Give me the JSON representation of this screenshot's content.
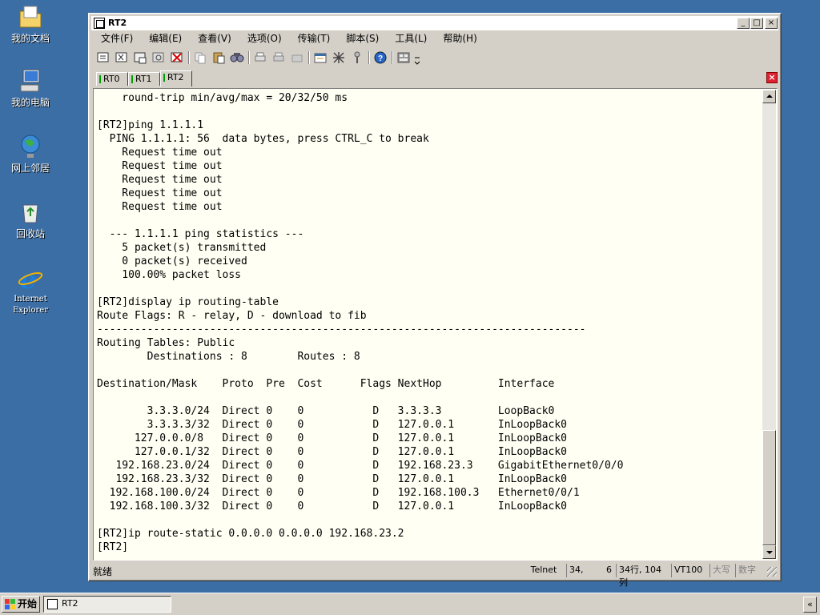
{
  "desktop": {
    "icons": [
      {
        "label": "我的文档"
      },
      {
        "label": "我的电脑"
      },
      {
        "label": "网上邻居"
      },
      {
        "label": "回收站"
      },
      {
        "label": "Internet Explorer"
      }
    ]
  },
  "window": {
    "title": "RT2",
    "controls": {
      "minimize": "_",
      "maximize": "□",
      "close": "×"
    }
  },
  "menu": [
    "文件(F)",
    "编辑(E)",
    "查看(V)",
    "选项(O)",
    "传输(T)",
    "脚本(S)",
    "工具(L)",
    "帮助(H)"
  ],
  "tabs": [
    {
      "label": "RT0"
    },
    {
      "label": "RT1"
    },
    {
      "label": "RT2",
      "active": true
    }
  ],
  "tab_close": "×",
  "terminal": {
    "lines": [
      "    round-trip min/avg/max = 20/32/50 ms",
      "",
      "[RT2]ping 1.1.1.1",
      "  PING 1.1.1.1: 56  data bytes, press CTRL_C to break",
      "    Request time out",
      "    Request time out",
      "    Request time out",
      "    Request time out",
      "    Request time out",
      "",
      "  --- 1.1.1.1 ping statistics ---",
      "    5 packet(s) transmitted",
      "    0 packet(s) received",
      "    100.00% packet loss",
      "",
      "[RT2]display ip routing-table",
      "Route Flags: R - relay, D - download to fib",
      "------------------------------------------------------------------------------",
      "Routing Tables: Public",
      "        Destinations : 8        Routes : 8",
      "",
      "Destination/Mask    Proto  Pre  Cost      Flags NextHop         Interface",
      "",
      "        3.3.3.0/24  Direct 0    0           D   3.3.3.3         LoopBack0",
      "        3.3.3.3/32  Direct 0    0           D   127.0.0.1       InLoopBack0",
      "      127.0.0.0/8   Direct 0    0           D   127.0.0.1       InLoopBack0",
      "      127.0.0.1/32  Direct 0    0           D   127.0.0.1       InLoopBack0",
      "   192.168.23.0/24  Direct 0    0           D   192.168.23.3    GigabitEthernet0/0/0",
      "   192.168.23.3/32  Direct 0    0           D   127.0.0.1       InLoopBack0",
      "  192.168.100.0/24  Direct 0    0           D   192.168.100.3   Ethernet0/0/1",
      "  192.168.100.3/32  Direct 0    0           D   127.0.0.1       InLoopBack0",
      "",
      "[RT2]ip route-static 0.0.0.0 0.0.0.0 192.168.23.2",
      "[RT2]"
    ]
  },
  "status": {
    "main": "就绪",
    "protocol": "Telnet",
    "cursor_row": "34,",
    "cursor_col": "6",
    "size": "34行, 104列",
    "emulation": "VT100",
    "caps": "大写",
    "num": "数字"
  },
  "taskbar": {
    "start": "开始",
    "task": "RT2",
    "tray": "«"
  }
}
